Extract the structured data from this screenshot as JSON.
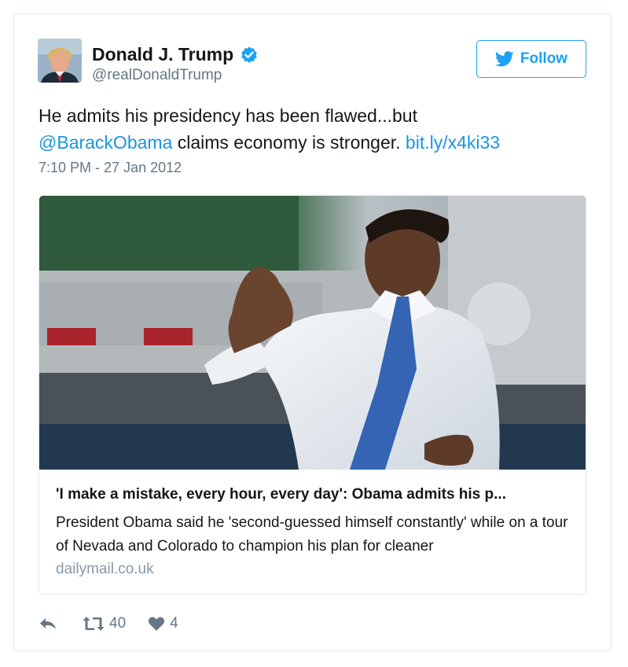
{
  "author": {
    "name": "Donald J. Trump",
    "handle": "@realDonaldTrump",
    "verified": true,
    "avatar_icon": "profile-photo"
  },
  "follow": {
    "label": "Follow",
    "icon": "twitter-bird-icon",
    "color": "#1da1f2"
  },
  "tweet": {
    "text_part1": "He admits his presidency has been flawed...but",
    "mention": "@BarackObama",
    "text_part2": " claims economy is stronger. ",
    "link": "bit.ly/x4ki33",
    "timestamp": "7:10 PM - 27 Jan 2012"
  },
  "card": {
    "image_icon": "news-photo",
    "title": "'I make a mistake, every hour, every day': Obama admits his p...",
    "description": "President Obama said he 'second-guessed himself constantly' while on a tour of Nevada and Colorado to champion his plan for cleaner",
    "domain": "dailymail.co.uk"
  },
  "actions": {
    "reply_icon": "reply-icon",
    "retweet_icon": "retweet-icon",
    "retweet_count": "40",
    "like_icon": "heart-icon",
    "like_count": "4"
  },
  "colors": {
    "link": "#1b95e0",
    "muted": "#657786",
    "border": "#e1e8ed",
    "text": "#14171a"
  }
}
